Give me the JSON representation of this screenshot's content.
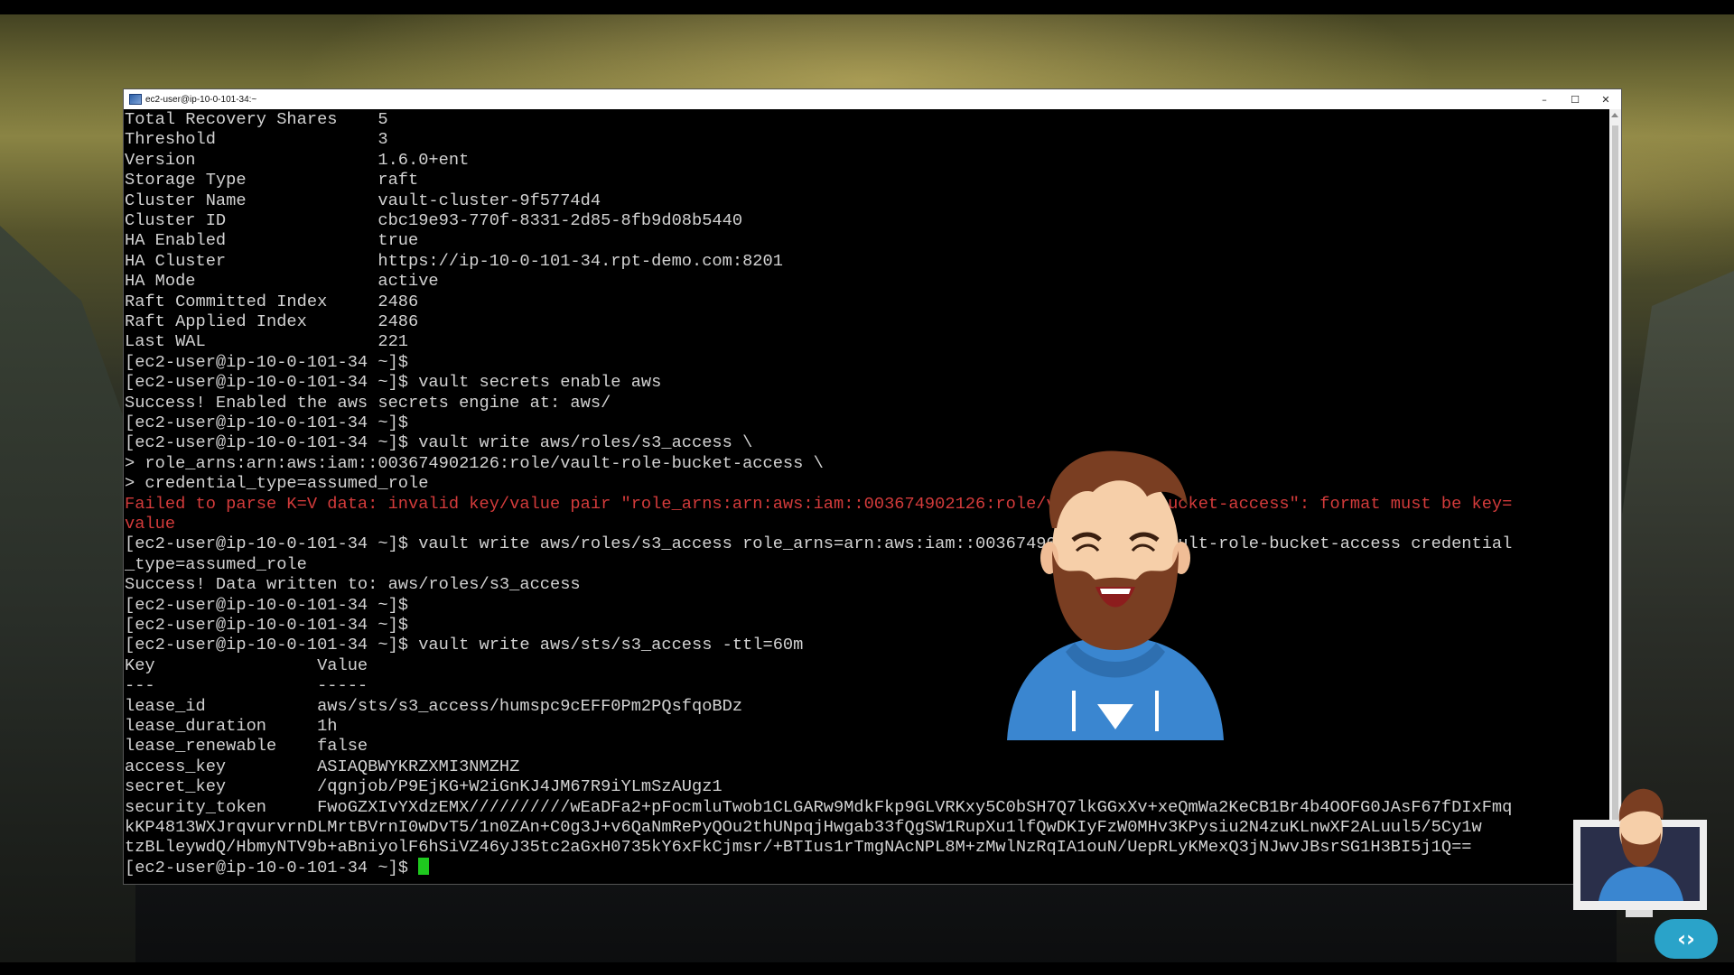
{
  "window": {
    "title": "ec2-user@ip-10-0-101-34:~",
    "controls": {
      "minimize": "–",
      "maximize": "☐",
      "close": "✕"
    }
  },
  "terminal": {
    "lines": [
      "Total Recovery Shares    5",
      "Threshold                3",
      "Version                  1.6.0+ent",
      "Storage Type             raft",
      "Cluster Name             vault-cluster-9f5774d4",
      "Cluster ID               cbc19e93-770f-8331-2d85-8fb9d08b5440",
      "HA Enabled               true",
      "HA Cluster               https://ip-10-0-101-34.rpt-demo.com:8201",
      "HA Mode                  active",
      "Raft Committed Index     2486",
      "Raft Applied Index       2486",
      "Last WAL                 221",
      "[ec2-user@ip-10-0-101-34 ~]$",
      "[ec2-user@ip-10-0-101-34 ~]$ vault secrets enable aws",
      "Success! Enabled the aws secrets engine at: aws/",
      "[ec2-user@ip-10-0-101-34 ~]$",
      "[ec2-user@ip-10-0-101-34 ~]$ vault write aws/roles/s3_access \\",
      "> role_arns:arn:aws:iam::003674902126:role/vault-role-bucket-access \\",
      "> credential_type=assumed_role",
      "Failed to parse K=V data: invalid key/value pair \"role_arns:arn:aws:iam::003674902126:role/vault-role-bucket-access\": format must be key=",
      "value",
      "[ec2-user@ip-10-0-101-34 ~]$ vault write aws/roles/s3_access role_arns=arn:aws:iam::003674902126:role/vault-role-bucket-access credential",
      "_type=assumed_role",
      "Success! Data written to: aws/roles/s3_access",
      "[ec2-user@ip-10-0-101-34 ~]$",
      "[ec2-user@ip-10-0-101-34 ~]$",
      "[ec2-user@ip-10-0-101-34 ~]$ vault write aws/sts/s3_access -ttl=60m",
      "Key                Value",
      "---                -----",
      "lease_id           aws/sts/s3_access/humspc9cEFF0Pm2PQsfqoBDz",
      "lease_duration     1h",
      "lease_renewable    false",
      "access_key         ASIAQBWYKRZXMI3NMZHZ",
      "secret_key         /qgnjob/P9EjKG+W2iGnKJ4JM67R9iYLmSzAUgz1",
      "security_token     FwoGZXIvYXdzEMX//////////wEaDFa2+pFocmluTwob1CLGARw9MdkFkp9GLVRKxy5C0bSH7Q7lkGGxXv+xeQmWa2KeCB1Br4b4OOFG0JAsF67fDIxFmq",
      "kKP4813WXJrqvurvrnDLMrtBVrnI0wDvT5/1n0ZAn+C0g3J+v6QaNmRePyQOu2thUNpqjHwgab33fQgSW1RupXu1lfQwDKIyFzW0MHv3KPysiu2N4zuKLnwXF2ALuul5/5Cy1w",
      "tzBLleywdQ/HbmyNTV9b+aBniyolF6hSiVZ46yJ35tc2aGxH0735kY6xFkCjmsr/+BTIus1rTmgNAcNPL8M+zMwlNzRqIA1ouN/UepRLyKMexQ3jNJwvJBsrSG1H3BI5j1Q=="
    ],
    "error_line_indexes": [
      19,
      20
    ],
    "prompt_current": "[ec2-user@ip-10-0-101-34 ~]$ ",
    "cursor_color": "#1ec81e",
    "text_color": "#d2d2d2",
    "error_color": "#d33b3b"
  },
  "overlays": {
    "presenter_avatar": "cartoon-presenter",
    "corner_logo": "code-brackets-icon"
  }
}
